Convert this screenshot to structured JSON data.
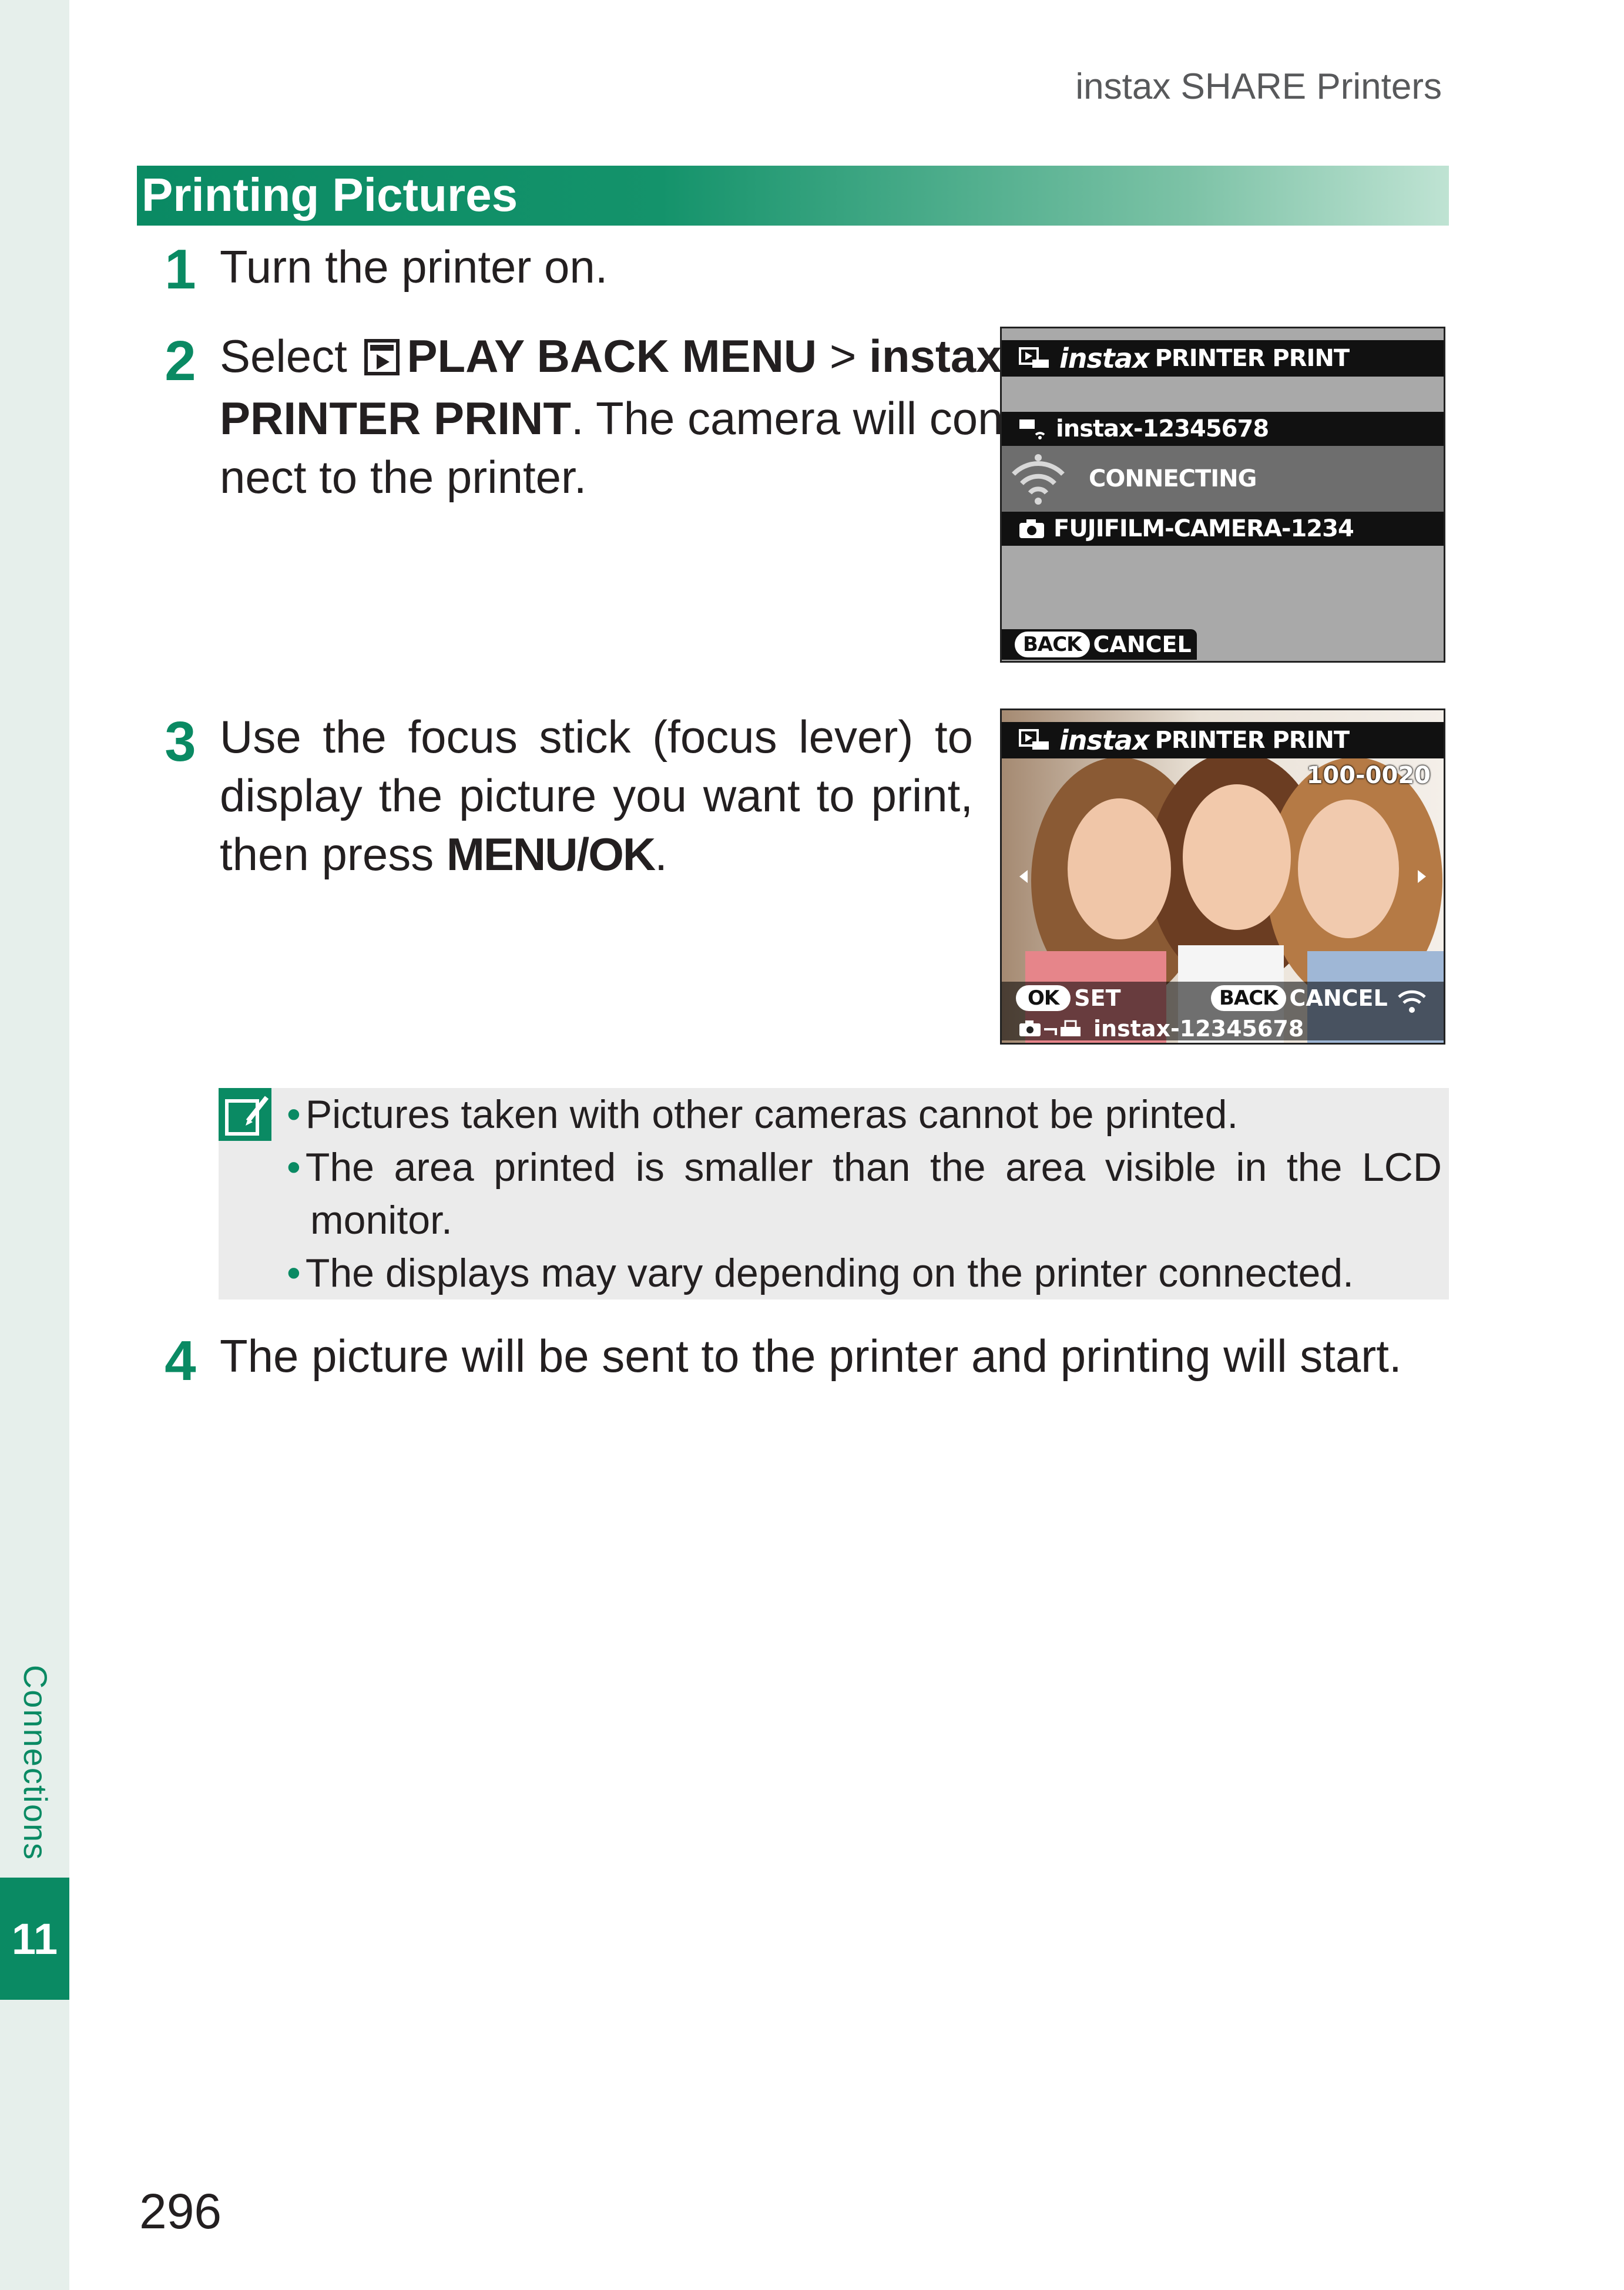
{
  "header": {
    "running_head": "instax SHARE Printers"
  },
  "side": {
    "section_label": "Connections",
    "chapter_number": "11"
  },
  "section": {
    "title": "Printing Pictures"
  },
  "steps": [
    {
      "num": "1",
      "text": "Turn the printer on."
    },
    {
      "num": "2",
      "pre": "Select ",
      "menu": "PLAY BACK MENU",
      "sep": " > ",
      "item_line1": "instax",
      "item_line2": "PRINTER PRINT",
      "post_line2": ". The camera will con-",
      "line3": "nect to the printer."
    },
    {
      "num": "3",
      "line1": "Use the focus stick (focus lever) to",
      "line2": "display the picture you want to print,",
      "line3_pre": "then press ",
      "line3_bold": "MENU/OK",
      "line3_post": "."
    },
    {
      "num": "4",
      "text": "The picture will be sent to the printer and printing will start."
    }
  ],
  "screen1": {
    "header_brand": "instax",
    "header_title": "PRINTER PRINT",
    "printer_id": "instax-12345678",
    "status": "CONNECTING",
    "camera_id": "FUJIFILM-CAMERA-1234",
    "back_key": "BACK",
    "cancel_label": "CANCEL"
  },
  "screen2": {
    "header_brand": "instax",
    "header_title": "PRINTER PRINT",
    "frame_number": "100-0020",
    "ok_key": "OK",
    "set_label": "SET",
    "back_key": "BACK",
    "cancel_label": "CANCEL",
    "printer_id": "instax-12345678"
  },
  "notes": [
    "Pictures taken with other cameras cannot be printed.",
    "The area printed is smaller than the area visible in the LCD",
    "monitor.",
    "The displays may vary depending on the printer connected."
  ],
  "footer": {
    "page_number": "296"
  },
  "colors": {
    "accent": "#0a8a63",
    "side_strip": "#e6efeb",
    "note_bg": "#ebebeb"
  }
}
